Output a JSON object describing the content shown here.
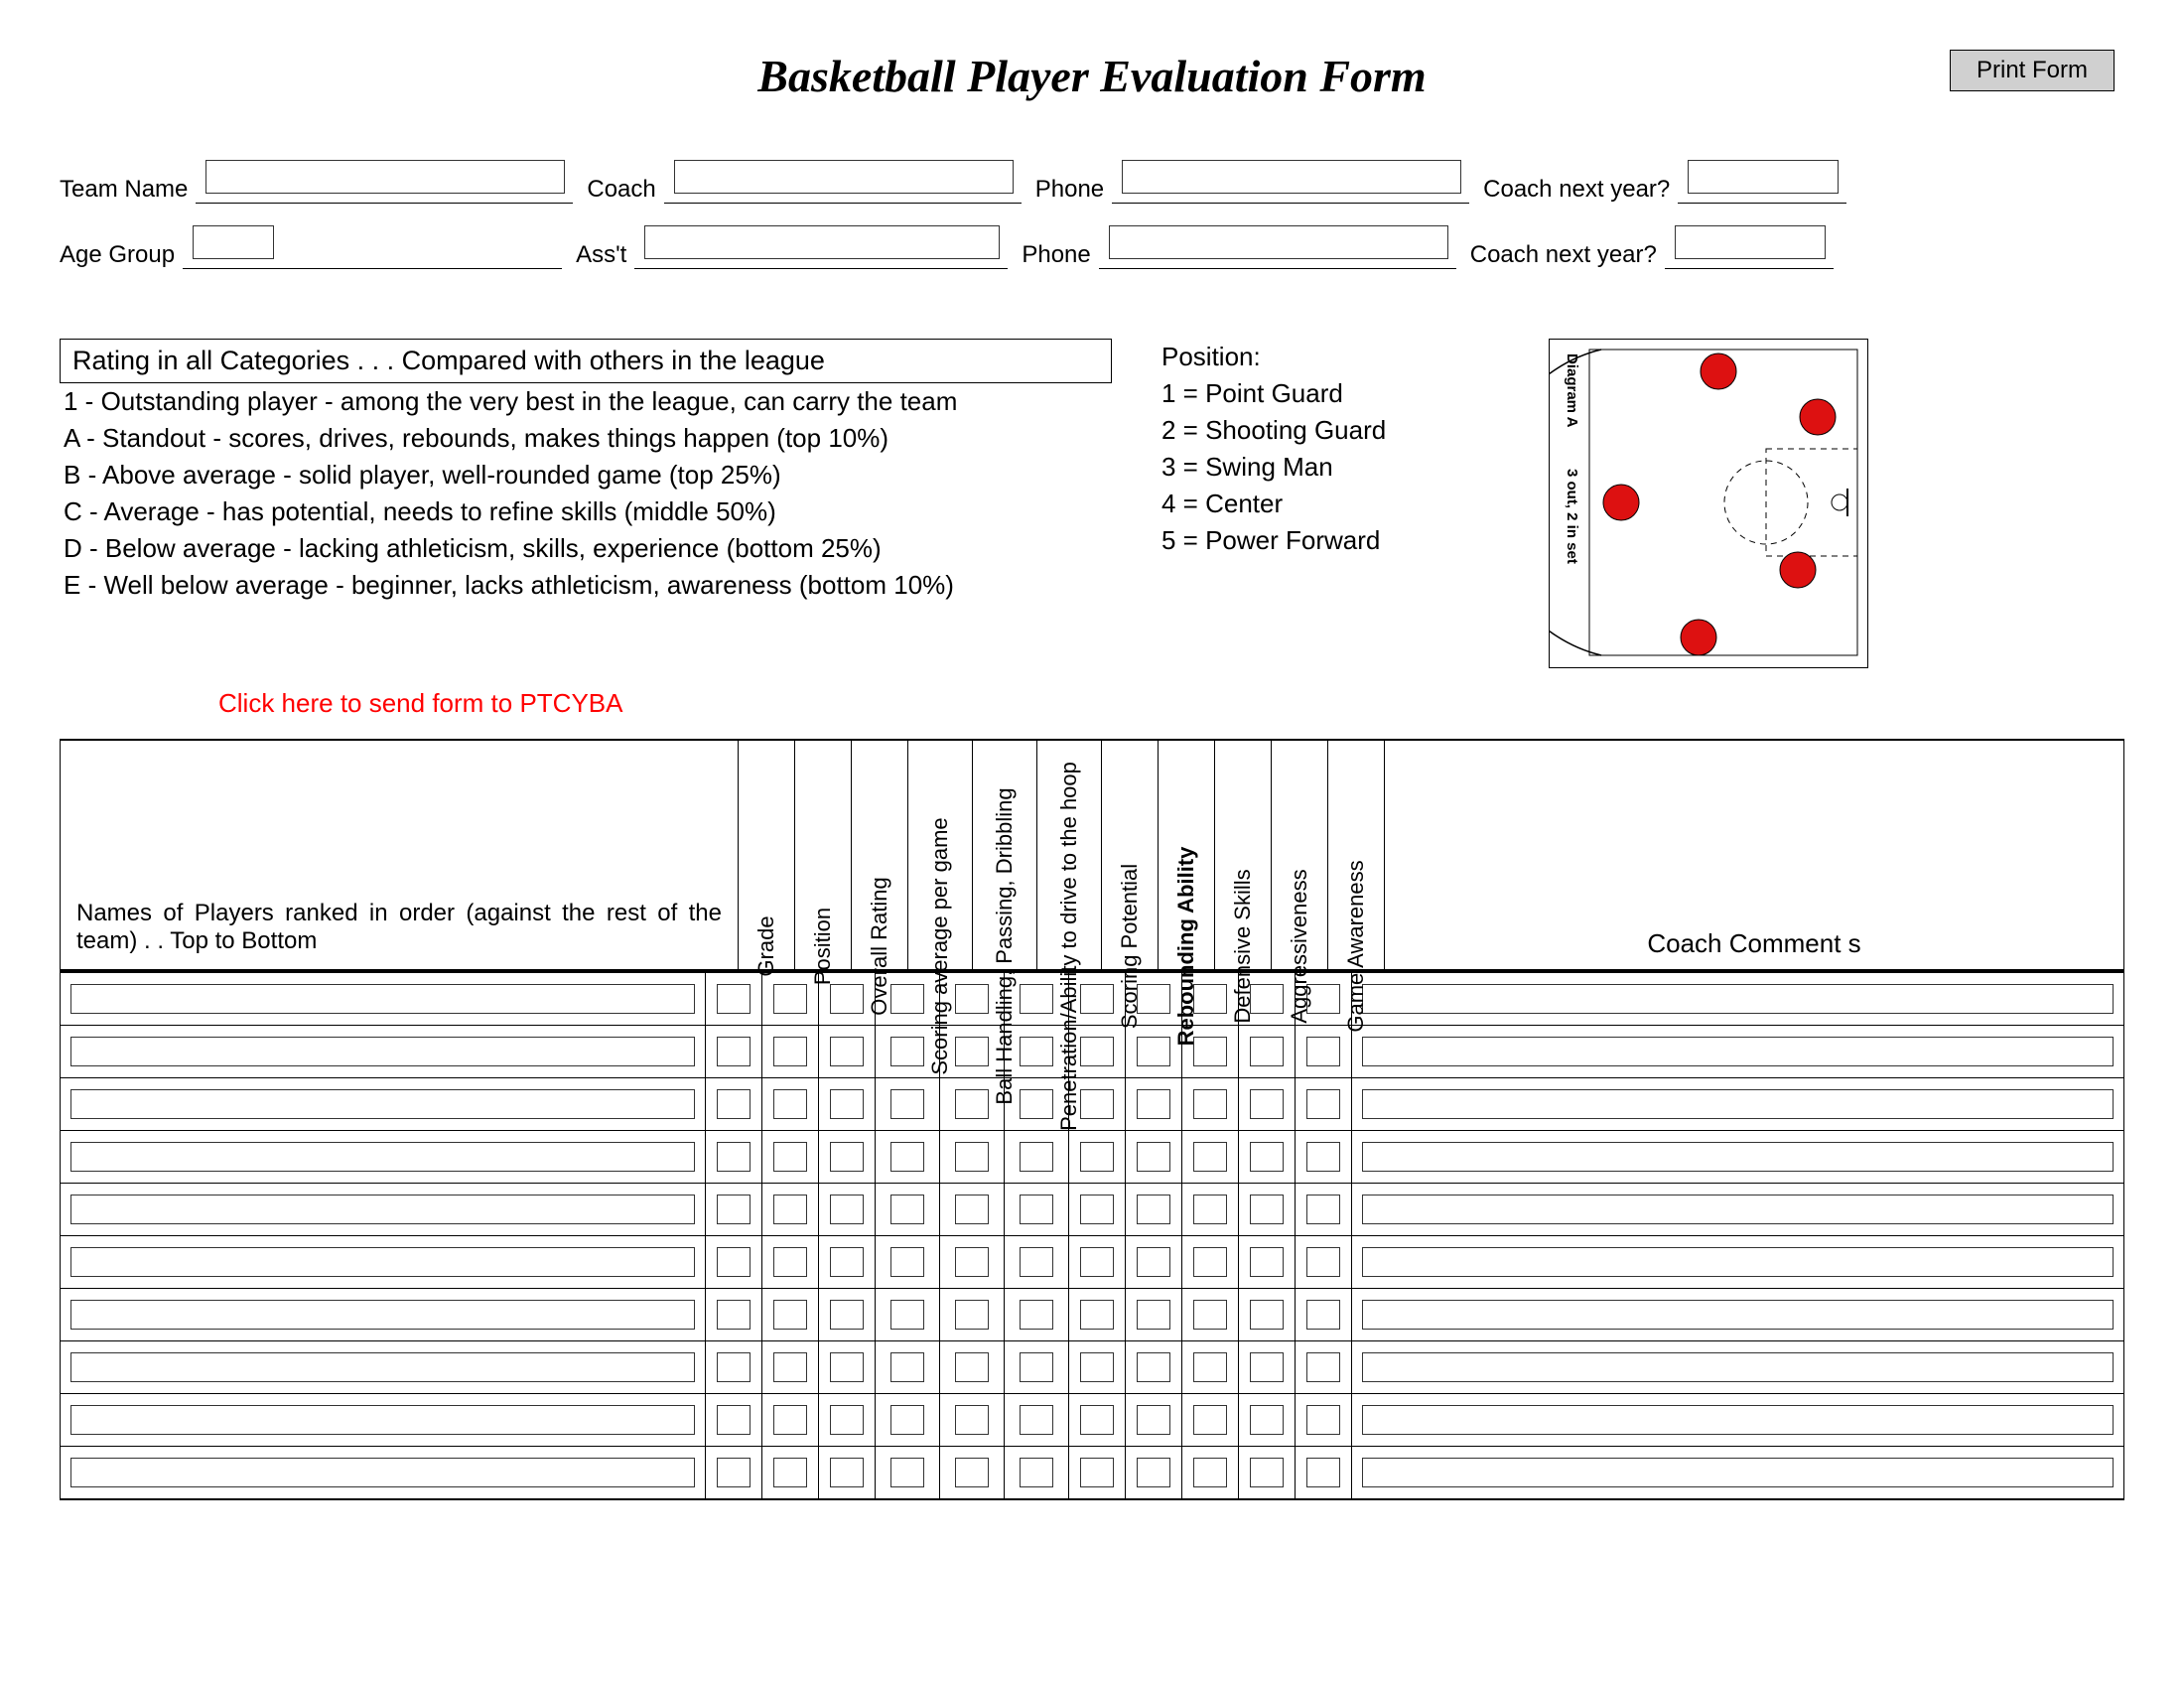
{
  "title": "Basketball Player Evaluation Form",
  "print_button": "Print Form",
  "info": {
    "row1": {
      "team_name_label": "Team Name",
      "coach_label": "Coach",
      "phone_label": "Phone",
      "next_label": "Coach next year?"
    },
    "row2": {
      "age_group_label": "Age Group",
      "asst_label": "Ass't",
      "phone_label": "Phone",
      "next_label": "Coach next year?"
    }
  },
  "rating": {
    "header": "Rating in all Categories . . . Compared with others in the league",
    "lines": [
      "1 - Outstanding player - among the very best in the league, can carry the team",
      "A - Standout - scores, drives, rebounds, makes things happen (top 10%)",
      "B - Above average - solid player, well-rounded game (top 25%)",
      "C - Average - has potential, needs to refine skills (middle 50%)",
      "D - Below average - lacking athleticism, skills, experience (bottom 25%)",
      "E - Well below average - beginner, lacks athleticism, awareness (bottom 10%)"
    ]
  },
  "positions": {
    "header": "Position:",
    "items": [
      "1 = Point Guard",
      "2 = Shooting Guard",
      "3 = Swing Man",
      "4 = Center",
      "5 = Power Forward"
    ]
  },
  "diagram": {
    "label_a": "Diagram A",
    "label_b": "3 out, 2 in set"
  },
  "send_link": "Click here to send form to PTCYBA",
  "table": {
    "names_header": "Names of Players ranked in order (against the rest of the team) . . Top to Bottom",
    "columns": [
      "Grade",
      "Position",
      "Overall Rating",
      "Scoring average per game",
      "Ball Handling, Passing, Dribbling",
      "Penetration/Ability to drive to the hoop",
      "Scoring Potential",
      "Rebounding Ability",
      "Defensive Skills",
      "Aggressiveness",
      "Game Awareness"
    ],
    "bold_columns": [
      7
    ],
    "comment_header": "Coach Comment s",
    "row_count": 10
  }
}
